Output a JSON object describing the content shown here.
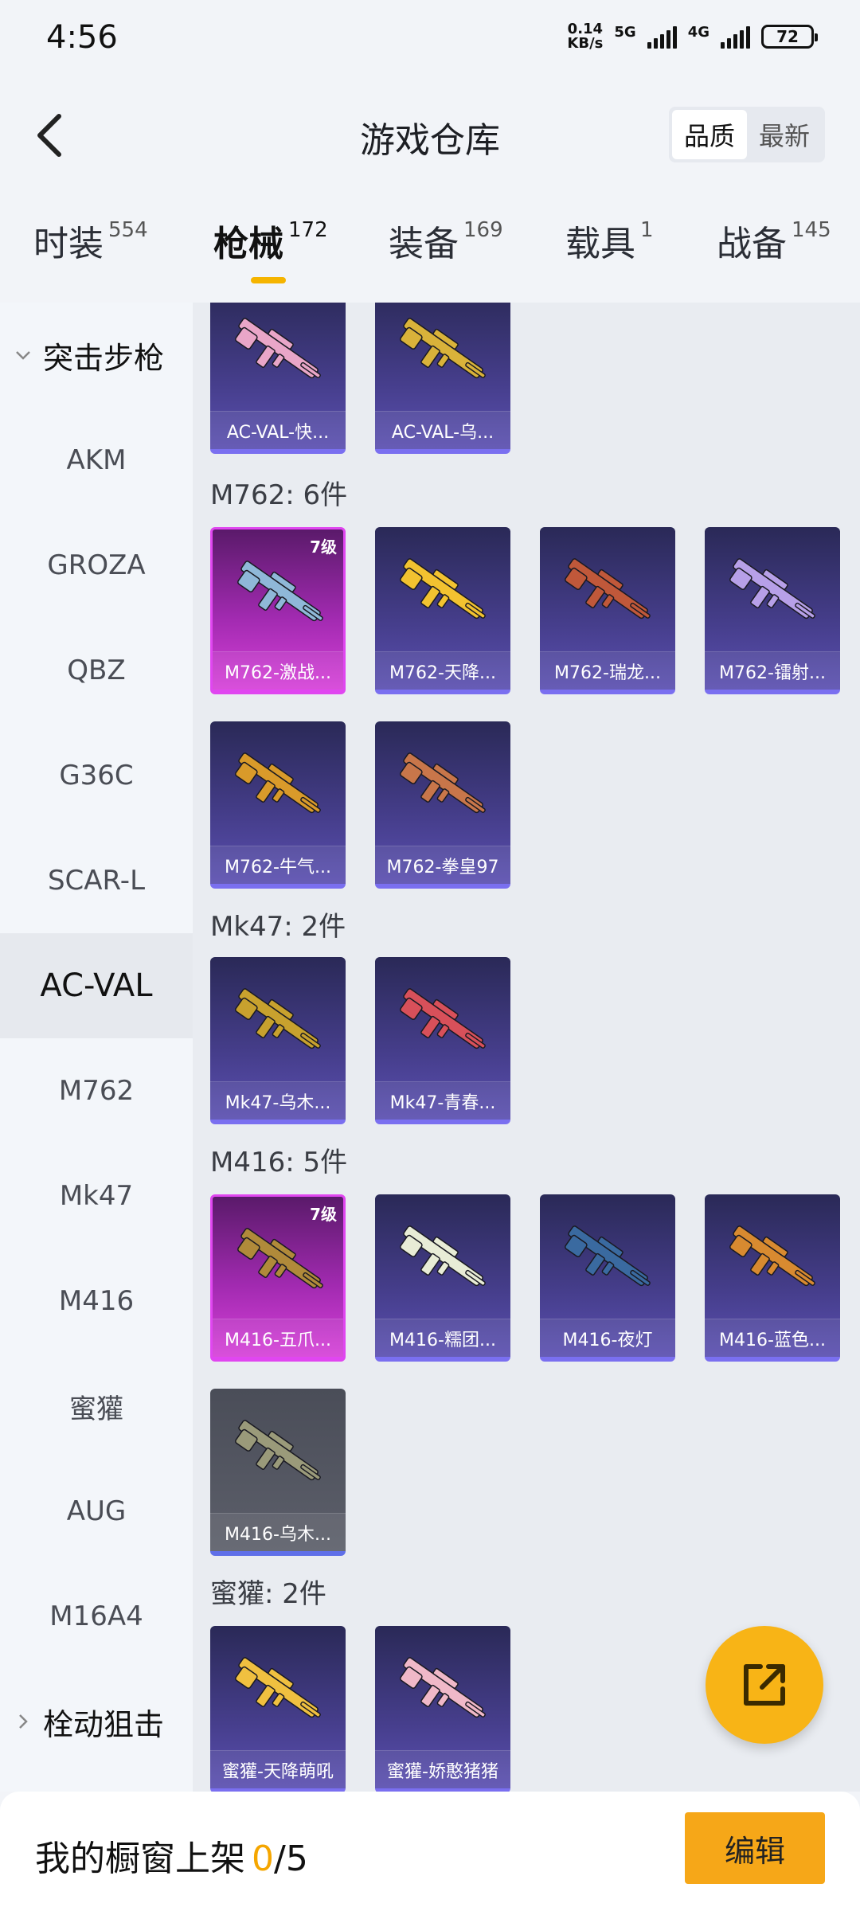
{
  "status_bar": {
    "time": "4:56",
    "net_speed_value": "0.14",
    "net_speed_unit": "KB/s",
    "sim1_label": "5G",
    "sim2_label": "4G",
    "battery": "72"
  },
  "header": {
    "title": "游戏仓库",
    "sort_options": [
      {
        "label": "品质",
        "selected": true
      },
      {
        "label": "最新",
        "selected": false
      }
    ]
  },
  "category_tabs": [
    {
      "label": "时装",
      "count": "554",
      "active": false
    },
    {
      "label": "枪械",
      "count": "172",
      "active": true
    },
    {
      "label": "装备",
      "count": "169",
      "active": false
    },
    {
      "label": "载具",
      "count": "1",
      "active": false
    },
    {
      "label": "战备",
      "count": "145",
      "active": false
    }
  ],
  "sidebar": {
    "group_expanded": "突击步枪",
    "items": [
      "AKM",
      "GROZA",
      "QBZ",
      "G36C",
      "SCAR-L",
      "AC-VAL",
      "M762",
      "Mk47",
      "M416",
      "蜜獾",
      "AUG",
      "M16A4"
    ],
    "active_item": "AC-VAL",
    "group_collapsed": "栓动狙击"
  },
  "sections": [
    {
      "title": "",
      "items": [
        {
          "name": "AC-VAL-快...",
          "level": "",
          "style": "purple",
          "color": "#e9a6c8"
        },
        {
          "name": "AC-VAL-乌...",
          "level": "",
          "style": "purple",
          "color": "#d9b23a"
        }
      ]
    },
    {
      "title": "M762: 6件",
      "items": [
        {
          "name": "M762-激战...",
          "level": "7级",
          "style": "pink",
          "color": "#8fb8d8"
        },
        {
          "name": "M762-天降...",
          "level": "",
          "style": "purple",
          "color": "#f2c230"
        },
        {
          "name": "M762-瑞龙...",
          "level": "",
          "style": "purple",
          "color": "#c0583a"
        },
        {
          "name": "M762-镭射...",
          "level": "",
          "style": "purple",
          "color": "#b7a0e8"
        },
        {
          "name": "M762-牛气...",
          "level": "",
          "style": "purple",
          "color": "#d99a2a"
        },
        {
          "name": "M762-拳皇97",
          "level": "",
          "style": "purple",
          "color": "#c8764a"
        }
      ]
    },
    {
      "title": "Mk47: 2件",
      "items": [
        {
          "name": "Mk47-乌木...",
          "level": "",
          "style": "purple",
          "color": "#c8a12e"
        },
        {
          "name": "Mk47-青春...",
          "level": "",
          "style": "purple",
          "color": "#d8505a"
        }
      ]
    },
    {
      "title": "M416: 5件",
      "items": [
        {
          "name": "M416-五爪...",
          "level": "7级",
          "style": "pink",
          "color": "#b08a3a"
        },
        {
          "name": "M416-糯团...",
          "level": "",
          "style": "purple",
          "color": "#e8ecd6"
        },
        {
          "name": "M416-夜灯",
          "level": "",
          "style": "purple",
          "color": "#3a6aa0"
        },
        {
          "name": "M416-蓝色...",
          "level": "",
          "style": "purple",
          "color": "#d88a30"
        },
        {
          "name": "M416-乌木...",
          "level": "",
          "style": "gray",
          "color": "#9a9a7a"
        }
      ]
    },
    {
      "title": "蜜獾: 2件",
      "items": [
        {
          "name": "蜜獾-天降萌吼",
          "level": "",
          "style": "purple",
          "color": "#f0c040"
        },
        {
          "name": "蜜獾-娇憨猪猪",
          "level": "",
          "style": "purple",
          "color": "#f0b8c8"
        }
      ]
    }
  ],
  "bottom_bar": {
    "shelf_label": "我的橱窗上架",
    "shelf_count": "0",
    "shelf_total": "/5",
    "edit_label": "编辑"
  },
  "icons": {
    "back": "back-arrow-icon",
    "share": "share-external-icon"
  }
}
